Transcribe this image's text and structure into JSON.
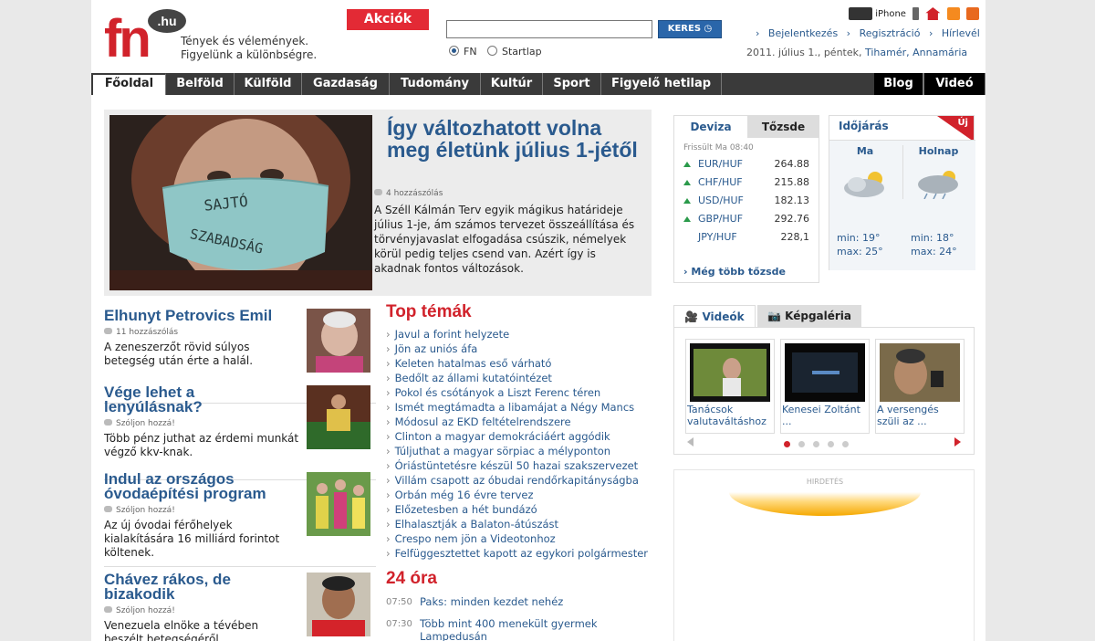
{
  "header": {
    "logo_text": "fn",
    "logo_domain": ".hu",
    "tagline_line1": "Tények és vélemények.",
    "tagline_line2": "Figyelünk a különbségre.",
    "promo_button": "Akciók",
    "search_value": "",
    "search_button": "KERES",
    "radio_options": [
      "FN",
      "Startlap"
    ],
    "iphone_label": "iPhone",
    "links": [
      "Bejelentkezés",
      "Regisztráció",
      "Hírlevél"
    ],
    "date": "2011. július 1., péntek,",
    "namedays": "Tihamér, Annamária"
  },
  "nav": {
    "items": [
      "Főoldal",
      "Belföld",
      "Külföld",
      "Gazdaság",
      "Tudomány",
      "Kultúr",
      "Sport",
      "Figyelő hetilap"
    ],
    "right_items": [
      "Blog",
      "Videó"
    ],
    "active": "Főoldal"
  },
  "feature": {
    "title": "Így változhatott volna meg életünk július 1-jétől",
    "comments": "4 hozzászólás",
    "lead": "A Széll Kálmán Terv egyik mágikus határideje július 1-je, ám számos tervezet összeállítása és törvényjavaslat elfogadása csúszik, némelyek körül pedig teljes csend van. Azért így is akadnak fontos változások.",
    "mask_text_1": "SAJTÓ",
    "mask_text_2": "SZABADSÁG"
  },
  "articles": [
    {
      "title": "Elhunyt Petrovics Emil",
      "comments": "11 hozzászólás",
      "lead": "A zeneszerzőt rövid súlyos betegség után érte a halál."
    },
    {
      "title": "Vége lehet a lenyúlásnak?",
      "comments": "Szóljon hozzá!",
      "lead": "Több pénz juthat az érdemi munkát végző kkv-knak."
    },
    {
      "title": "Indul az országos óvodaépítési program",
      "comments": "Szóljon hozzá!",
      "lead": "Az új óvodai férőhelyek kialakítására 16 milliárd forintot költenek."
    },
    {
      "title": "Chávez rákos, de bizakodik",
      "comments": "Szóljon hozzá!",
      "lead": "Venezuela elnöke a tévében beszélt betegségéről"
    }
  ],
  "top_topics": {
    "title": "Top témák",
    "items": [
      "Javul a forint helyzete",
      "Jön az uniós áfa",
      "Keleten hatalmas eső várható",
      "Bedőlt az állami kutatóintézet",
      "Pokol és csótányok a Liszt Ferenc téren",
      "Ismét megtámadta a libamájat a Négy Mancs",
      "Módosul az EKD feltételrendszere",
      "Clinton a magyar demokráciáért aggódik",
      "Túljuthat a magyar sörpiac a mélyponton",
      "Óriástüntetésre készül 50 hazai szakszervezet",
      "Villám csapott az óbudai rendőrkapitányságba",
      "Orbán még 16 évre tervez",
      "Előzetesben a hét bundázó",
      "Elhalasztják a Balaton-átúszást",
      "Crespo nem jön a Videotonhoz",
      "Felfüggesztettet kapott az egykori polgármester"
    ]
  },
  "h24": {
    "title": "24 óra",
    "items": [
      {
        "time": "07:50",
        "text": "Paks: minden kezdet nehéz"
      },
      {
        "time": "07:30",
        "text": "Több mint 400 menekült gyermek Lampedusán"
      }
    ]
  },
  "fx": {
    "tabs": [
      "Deviza",
      "Tőzsde"
    ],
    "updated": "Frissült Ma 08:40",
    "rows": [
      {
        "name": "EUR/HUF",
        "value": "264.88",
        "up": true
      },
      {
        "name": "CHF/HUF",
        "value": "215.88",
        "up": true
      },
      {
        "name": "USD/HUF",
        "value": "182.13",
        "up": true
      },
      {
        "name": "GBP/HUF",
        "value": "292.76",
        "up": true
      },
      {
        "name": "JPY/HUF",
        "value": "228,1",
        "up": false
      }
    ],
    "more": "Még több tőzsde"
  },
  "weather": {
    "title": "Időjárás",
    "badge": "Új",
    "days": [
      {
        "label": "Ma",
        "min": "min: 19°",
        "max": "max: 25°"
      },
      {
        "label": "Holnap",
        "min": "min: 18°",
        "max": "max: 24°"
      }
    ]
  },
  "media": {
    "tabs": [
      "Videók",
      "Képgaléria"
    ],
    "videos": [
      {
        "caption": "Tanácsok valutaváltáshoz"
      },
      {
        "caption": "Kenesei Zoltánt ..."
      },
      {
        "caption": "A versengés szüli az ..."
      }
    ]
  },
  "ad": {
    "label": "HIRDETÉS"
  },
  "colors": {
    "brand_red": "#d1222b",
    "link_blue": "#2a5a8e",
    "nav_bg": "#3a3a3a"
  }
}
